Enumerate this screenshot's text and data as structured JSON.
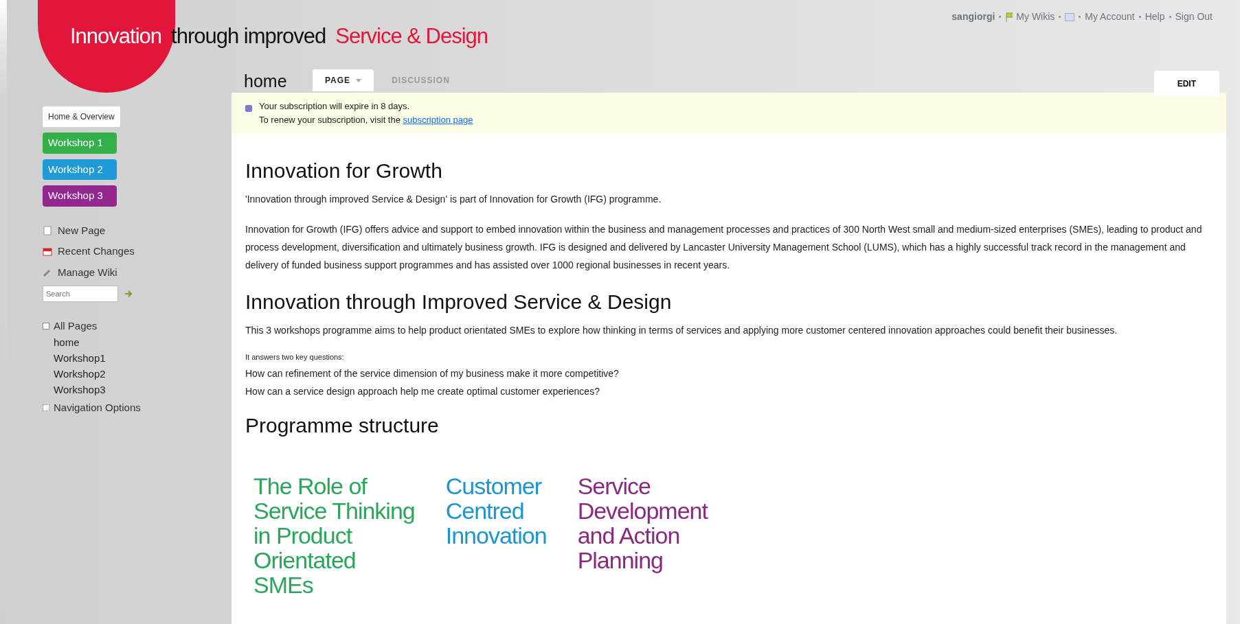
{
  "header": {
    "title_parts": [
      {
        "text": "Innovation",
        "kind": "circle"
      },
      {
        "text": "through improved",
        "kind": "plain"
      },
      {
        "text": "Service & Design",
        "kind": "accent"
      }
    ]
  },
  "user_links": [
    {
      "text": "sangiorgi",
      "kind": "user"
    },
    {
      "text": "My Wikis",
      "kind": "wikis"
    },
    {
      "kind": "badge"
    },
    {
      "text": "My Account",
      "kind": "link"
    },
    {
      "text": "Help",
      "kind": "link"
    },
    {
      "text": "Sign Out",
      "kind": "link"
    }
  ],
  "page": {
    "name": "home",
    "tabs": [
      {
        "label": "PAGE",
        "selected": true,
        "dropdown": true
      },
      {
        "label": "DISCUSSION",
        "selected": false,
        "dropdown": false
      }
    ],
    "edit_button": "EDIT"
  },
  "sidebar": {
    "home_link": "Home & Overview",
    "workshops": [
      {
        "label": "Workshop 1",
        "color": "#34b04a"
      },
      {
        "label": "Workshop 2",
        "color": "#1e9ad8"
      },
      {
        "label": "Workshop 3",
        "color": "#93268f"
      }
    ],
    "tools": [
      {
        "label": "New Page",
        "kind": "new"
      },
      {
        "label": "Recent Changes",
        "kind": "recent"
      },
      {
        "label": "Manage Wiki",
        "kind": "manage"
      }
    ],
    "search": {
      "placeholder": "Search"
    },
    "tree": [
      {
        "label": "All Pages",
        "expanded": true,
        "children": [
          {
            "label": "home"
          },
          {
            "label": "Workshop1"
          },
          {
            "label": "Workshop2"
          },
          {
            "label": "Workshop3"
          }
        ]
      },
      {
        "label": "Navigation Options",
        "expanded": false
      }
    ]
  },
  "notice": {
    "line1": "Your subscription will expire in 8 days.",
    "line2": "To renew your subscription, visit the",
    "link": "subscription page"
  },
  "content": [
    {
      "kind": "h",
      "text": "Innovation for Growth"
    },
    {
      "kind": "p",
      "text": "'Innovation through improved Service & Design' is part of Innovation for Growth (IFG) programme."
    },
    {
      "kind": "p",
      "text": "Innovation for Growth (IFG) offers advice and support to embed innovation within the business and management processes and practices of 300 North West small and medium-sized enterprises (SMEs), leading to product and process development, diversification and ultimately business growth. IFG is designed and delivered by Lancaster University Management School (LUMS), which has a highly successful track record in the management and delivery of funded business support programmes and has assisted over 1000 regional businesses in recent years."
    },
    {
      "kind": "h",
      "text": "Innovation through Improved Service & Design"
    },
    {
      "kind": "p",
      "text": "This 3 workshops programme aims to help product orientated SMEs to explore how thinking in terms of services and applying more customer centered innovation approaches could benefit their businesses."
    },
    {
      "kind": "small",
      "text": "It answers two key questions:"
    },
    {
      "kind": "line",
      "text": "How can refinement of the service dimension of my business make it more competitive?"
    },
    {
      "kind": "line",
      "text": "How can a service design approach help me create optimal customer experiences?"
    },
    {
      "kind": "h",
      "text": "Programme structure"
    }
  ],
  "structure": [
    {
      "text": "The Role of\nService Thinking\nin Product\nOrientated\nSMEs",
      "color": "#2aa65a"
    },
    {
      "text": "Customer\nCentred\nInnovation",
      "color": "#1a96cf"
    },
    {
      "text": "Service\nDevelopment\nand Action\nPlanning",
      "color": "#8a2a7e"
    }
  ]
}
